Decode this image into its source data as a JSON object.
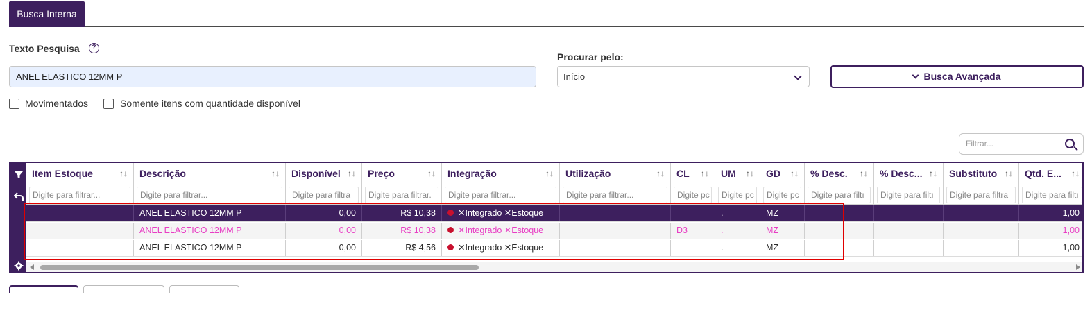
{
  "tab": {
    "label": "Busca Interna"
  },
  "search": {
    "label": "Texto Pesquisa",
    "value": "ANEL ELASTICO 12MM P"
  },
  "procurar": {
    "label": "Procurar pelo:",
    "selected": "Início"
  },
  "advanced_button": "Busca Avançada",
  "checkboxes": {
    "movimentados": "Movimentados",
    "somente": "Somente itens com quantidade disponível"
  },
  "filter_box": {
    "placeholder": "Filtrar..."
  },
  "columns": [
    {
      "label": "Item Estoque",
      "filter": "Digite para filtrar..."
    },
    {
      "label": "Descrição",
      "filter": "Digite para filtrar..."
    },
    {
      "label": "Disponível",
      "filter": "Digite para filtra"
    },
    {
      "label": "Preço",
      "filter": "Digite para filtrar."
    },
    {
      "label": "Integração",
      "filter": "Digite para filtrar..."
    },
    {
      "label": "Utilização",
      "filter": "Digite para filtrar..."
    },
    {
      "label": "CL",
      "filter": "Digite pc"
    },
    {
      "label": "UM",
      "filter": "Digite pc"
    },
    {
      "label": "GD",
      "filter": "Digite pc"
    },
    {
      "label": "% Desc.",
      "filter": "Digite para filtı"
    },
    {
      "label": "% Desc...",
      "filter": "Digite para filtı"
    },
    {
      "label": "Substituto",
      "filter": "Digite para filtra"
    },
    {
      "label": "Qtd. E...",
      "filter": "Digite para filtı"
    }
  ],
  "rows": [
    {
      "item": "",
      "descricao": "ANEL ELASTICO 12MM P",
      "disponivel": "0,00",
      "preco": "R$ 10,38",
      "integracao": "✕Integrado ✕Estoque",
      "utilizacao": "",
      "cl": "",
      "um": ".",
      "gd": "MZ",
      "desc1": "",
      "desc2": "",
      "substituto": "",
      "qtd": "1,00"
    },
    {
      "item": "",
      "descricao": "ANEL ELASTICO 12MM P",
      "disponivel": "0,00",
      "preco": "R$ 10,38",
      "integracao": "✕Integrado ✕Estoque",
      "utilizacao": "",
      "cl": "D3",
      "um": ".",
      "gd": "MZ",
      "desc1": "",
      "desc2": "",
      "substituto": "",
      "qtd": "1,00"
    },
    {
      "item": "",
      "descricao": "ANEL ELASTICO 12MM P",
      "disponivel": "0,00",
      "preco": "R$ 4,56",
      "integracao": "✕Integrado ✕Estoque",
      "utilizacao": "",
      "cl": "",
      "um": ".",
      "gd": "MZ",
      "desc1": "",
      "desc2": "",
      "substituto": "",
      "qtd": "1,00"
    }
  ],
  "colors": {
    "primary": "#3d1f5e",
    "highlight_text": "#e83ec4",
    "status_dot": "#c8102e",
    "annotation": "#e00000"
  }
}
